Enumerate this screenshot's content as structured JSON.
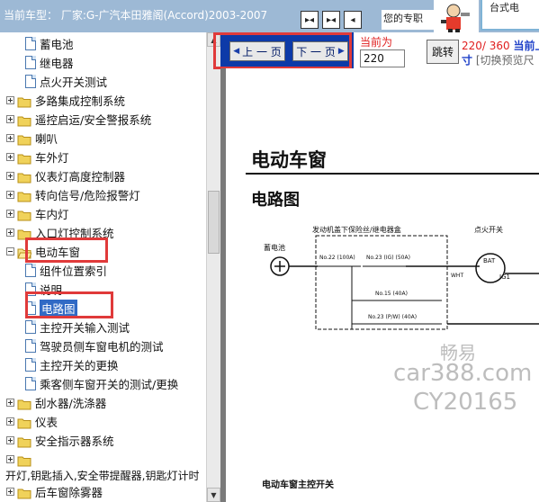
{
  "header": {
    "car_prefix": "当前车型：",
    "car_name": "厂家:G-广汽本田雅阁(Accord)2003-2007",
    "pro_label": "您的专职",
    "ad_label": "台式电"
  },
  "tree": {
    "items": [
      {
        "label": "蓄电池",
        "kind": "doc",
        "indent": 1
      },
      {
        "label": "继电器",
        "kind": "doc",
        "indent": 1
      },
      {
        "label": "点火开关测试",
        "kind": "doc",
        "indent": 1
      },
      {
        "label": "多路集成控制系统",
        "kind": "folder",
        "indent": 0
      },
      {
        "label": "遥控启运/安全警报系统",
        "kind": "folder",
        "indent": 0
      },
      {
        "label": "喇叭",
        "kind": "folder",
        "indent": 0
      },
      {
        "label": "车外灯",
        "kind": "folder",
        "indent": 0
      },
      {
        "label": "仪表灯高度控制器",
        "kind": "folder",
        "indent": 0
      },
      {
        "label": "转向信号/危险报警灯",
        "kind": "folder",
        "indent": 0
      },
      {
        "label": "车内灯",
        "kind": "folder",
        "indent": 0
      },
      {
        "label": "入口灯控制系统",
        "kind": "folder",
        "indent": 0
      },
      {
        "label": "电动车窗",
        "kind": "folder-open",
        "indent": 0
      },
      {
        "label": "组件位置索引",
        "kind": "doc",
        "indent": 1
      },
      {
        "label": "说明",
        "kind": "doc",
        "indent": 1
      },
      {
        "label": "电路图",
        "kind": "doc",
        "indent": 1,
        "selected": true
      },
      {
        "label": "主控开关输入测试",
        "kind": "doc",
        "indent": 1
      },
      {
        "label": "驾驶员侧车窗电机的测试",
        "kind": "doc",
        "indent": 1
      },
      {
        "label": "主控开关的更换",
        "kind": "doc",
        "indent": 1
      },
      {
        "label": "乘客侧车窗开关的测试/更换",
        "kind": "doc",
        "indent": 1
      },
      {
        "label": "刮水器/洗涤器",
        "kind": "folder",
        "indent": 0
      },
      {
        "label": "仪表",
        "kind": "folder",
        "indent": 0
      },
      {
        "label": "安全指示器系统",
        "kind": "folder",
        "indent": 0
      },
      {
        "label": "",
        "kind": "folder",
        "indent": 0
      }
    ],
    "cut_row": "开灯,钥匙插入,安全带提醒器,钥匙灯计时",
    "last_item": "后车窗除雾器"
  },
  "pager": {
    "prev_label": "上 一 页",
    "next_label": "下 一 页",
    "current_label": "当前为",
    "page_value": "220",
    "jump_label": "跳转",
    "page_count": "220/ 360",
    "current_label2": "当前上",
    "page_unit": "寸",
    "preview_hint": "[切换预览尺"
  },
  "document": {
    "title": "电动车窗",
    "subtitle": "电路图",
    "fuse_box_label": "发动机盖下保险丝/继电器盒",
    "battery_label": "蓄电池",
    "ignition_label": "点火开关",
    "fuse_22": "No.22 (100A)",
    "fuse_23_ig": "No.23 (IG) (50A)",
    "fuse_15": "No.15 (40A)",
    "fuse_23_pw": "No.23 (P/W) (40A)",
    "wire_whit": "WHT",
    "bat_label": "BAT",
    "ig1_label": "IG1",
    "master_switch_label": "电动车窗主控开关"
  },
  "watermark": {
    "line1": "畅易",
    "line2": "car388.com",
    "line3": "CY20165"
  }
}
